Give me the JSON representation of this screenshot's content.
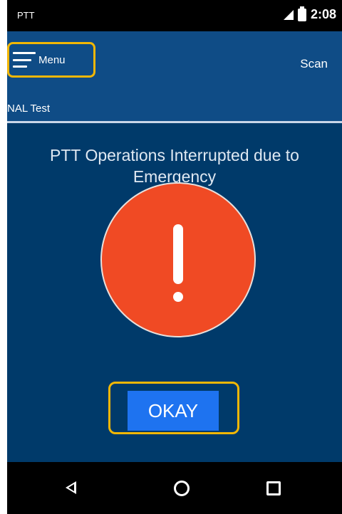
{
  "status_bar": {
    "carrier": "PTT",
    "time": "2:08",
    "icons": [
      "signal-icon",
      "battery-icon"
    ]
  },
  "app_bar": {
    "menu_label": "Menu",
    "scan_label": "Scan"
  },
  "group": {
    "name": "NAL Test"
  },
  "alert": {
    "message": "PTT Operations Interrupted due to Emergency",
    "icon": "exclamation-icon",
    "button_label": "OKAY"
  },
  "nav_bar": {
    "icons": [
      "back-icon",
      "home-icon",
      "recents-icon"
    ]
  },
  "colors": {
    "app_bar": "#0f4c86",
    "content_bg": "#003a6a",
    "alert_circle": "#f04a24",
    "okay_button": "#1e73f0",
    "highlight": "#f2b705"
  }
}
